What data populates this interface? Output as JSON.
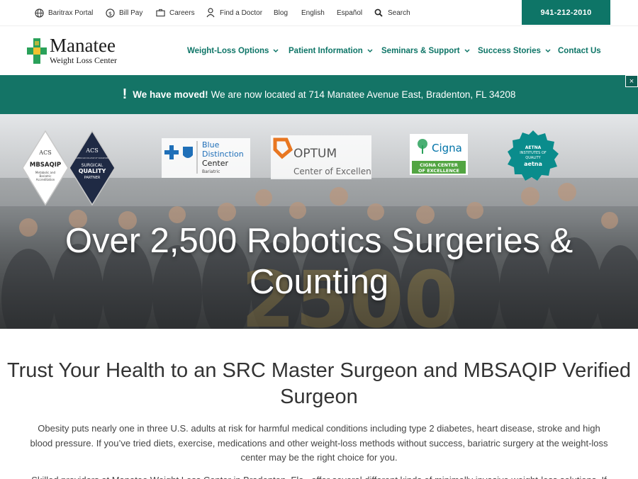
{
  "topbar": {
    "items": [
      {
        "label": "Baritrax Portal",
        "icon": "globe-icon"
      },
      {
        "label": "Bill Pay",
        "icon": "dollar-icon"
      },
      {
        "label": "Careers",
        "icon": "briefcase-icon"
      },
      {
        "label": "Find a Doctor",
        "icon": "doctor-icon"
      },
      {
        "label": "Blog"
      },
      {
        "label": "English"
      },
      {
        "label": "Español"
      },
      {
        "label": "Search",
        "icon": "search-icon"
      }
    ],
    "phone": "941-212-2010"
  },
  "logo": {
    "title": "Manatee",
    "subtitle": "Weight Loss Center"
  },
  "nav": [
    {
      "label": "Weight-Loss Options",
      "has_dropdown": true
    },
    {
      "label": "Patient Information",
      "has_dropdown": true
    },
    {
      "label": "Seminars & Support",
      "has_dropdown": true
    },
    {
      "label": "Success Stories",
      "has_dropdown": true
    },
    {
      "label": "Contact Us",
      "has_dropdown": false
    }
  ],
  "notice": {
    "strong": "We have moved!",
    "text": "We are now located at 714 Manatee Avenue East, Bradenton, FL 34208",
    "close": "×"
  },
  "badges": {
    "acs_mbsaqip": {
      "top": "ACS",
      "main": "MBSAQIP",
      "sub1": "Metabolic and",
      "sub2": "Bariatric",
      "sub3": "Accreditation"
    },
    "acs_quality": {
      "top": "ACS",
      "small": "AMERICAN COLLEGE OF SURGEONS",
      "line1": "SURGICAL",
      "line2": "QUALITY",
      "line3": "PARTNER"
    },
    "bcbs": {
      "line1": "Blue",
      "line2": "Distinction",
      "line3": "Center",
      "line4": "Bariatric"
    },
    "optum": {
      "name": "OPTUM",
      "sub": "Center of Excellence"
    },
    "cigna": {
      "name": "Cigna",
      "line1": "CIGNA CENTER",
      "line2": "OF EXCELLENCE"
    },
    "aetna": {
      "line1": "AETNA",
      "line2": "INSTITUTES OF",
      "line3": "QUALITY",
      "name": "aetna"
    }
  },
  "hero": {
    "title": "Over 2,500 Robotics Surgeries & Counting"
  },
  "content": {
    "title": "Trust Your Health to an SRC Master Surgeon and MBSAQIP Verified Surgeon",
    "para1": "Obesity puts nearly one in three U.S. adults at risk for harmful medical conditions including type 2 diabetes, heart disease, stroke and high blood pressure. If you’ve tried diets, exercise, medications and other weight-loss methods without success, bariatric surgery at the weight-loss center may be the right choice for you.",
    "para2": "Skilled providers at Manatee Weight Loss Center in Bradenton, Fla., offer several different kinds of minimally invasive weight-loss solutions. If"
  },
  "colors": {
    "brand_green": "#0e7567",
    "notice_green": "#147466",
    "logo_yellow": "#f2c230",
    "logo_green": "#2aa15a"
  }
}
